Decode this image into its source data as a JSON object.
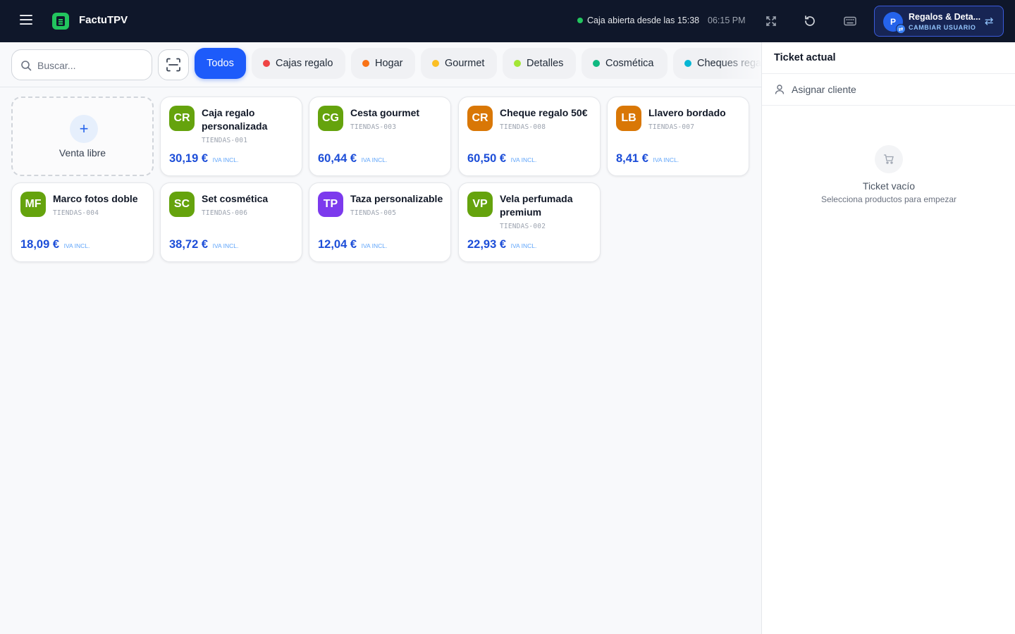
{
  "header": {
    "app_title": "FactuTPV",
    "status_text": "Caja abierta desde las 15:38",
    "status_color": "#22c55e",
    "time": "06:15 PM",
    "user": {
      "initial": "P",
      "name": "Regalos & Deta...",
      "subtitle": "CAMBIAR USUARIO"
    }
  },
  "search": {
    "placeholder": "Buscar...",
    "value": ""
  },
  "categories": [
    {
      "label": "Todos",
      "active": true
    },
    {
      "label": "Cajas regalo",
      "color": "#ef4444"
    },
    {
      "label": "Hogar",
      "color": "#f97316"
    },
    {
      "label": "Gourmet",
      "color": "#fbbf24"
    },
    {
      "label": "Detalles",
      "color": "#a3e635"
    },
    {
      "label": "Cosmética",
      "color": "#10b981"
    },
    {
      "label": "Cheques regalo",
      "color": "#06b6d4"
    }
  ],
  "free_sale": {
    "label": "Venta libre"
  },
  "price_suffix": "IVA INCL.",
  "products": [
    {
      "initials": "CR",
      "color": "#65a30d",
      "name": "Caja regalo personalizada",
      "sku": "TIENDAS-001",
      "price": "30,19 €"
    },
    {
      "initials": "CG",
      "color": "#65a30d",
      "name": "Cesta gourmet",
      "sku": "TIENDAS-003",
      "price": "60,44 €"
    },
    {
      "initials": "CR",
      "color": "#d97706",
      "name": "Cheque regalo 50€",
      "sku": "TIENDAS-008",
      "price": "60,50 €"
    },
    {
      "initials": "LB",
      "color": "#d97706",
      "name": "Llavero bordado",
      "sku": "TIENDAS-007",
      "price": "8,41 €"
    },
    {
      "initials": "MF",
      "color": "#65a30d",
      "name": "Marco fotos doble",
      "sku": "TIENDAS-004",
      "price": "18,09 €"
    },
    {
      "initials": "SC",
      "color": "#65a30d",
      "name": "Set cosmética",
      "sku": "TIENDAS-006",
      "price": "38,72 €"
    },
    {
      "initials": "TP",
      "color": "#7c3aed",
      "name": "Taza personalizable",
      "sku": "TIENDAS-005",
      "price": "12,04 €"
    },
    {
      "initials": "VP",
      "color": "#65a30d",
      "name": "Vela perfumada premium",
      "sku": "TIENDAS-002",
      "price": "22,93 €"
    }
  ],
  "ticket": {
    "title": "Ticket actual",
    "assign_label": "Asignar cliente",
    "empty_title": "Ticket vacío",
    "empty_subtitle": "Selecciona productos para empezar"
  }
}
